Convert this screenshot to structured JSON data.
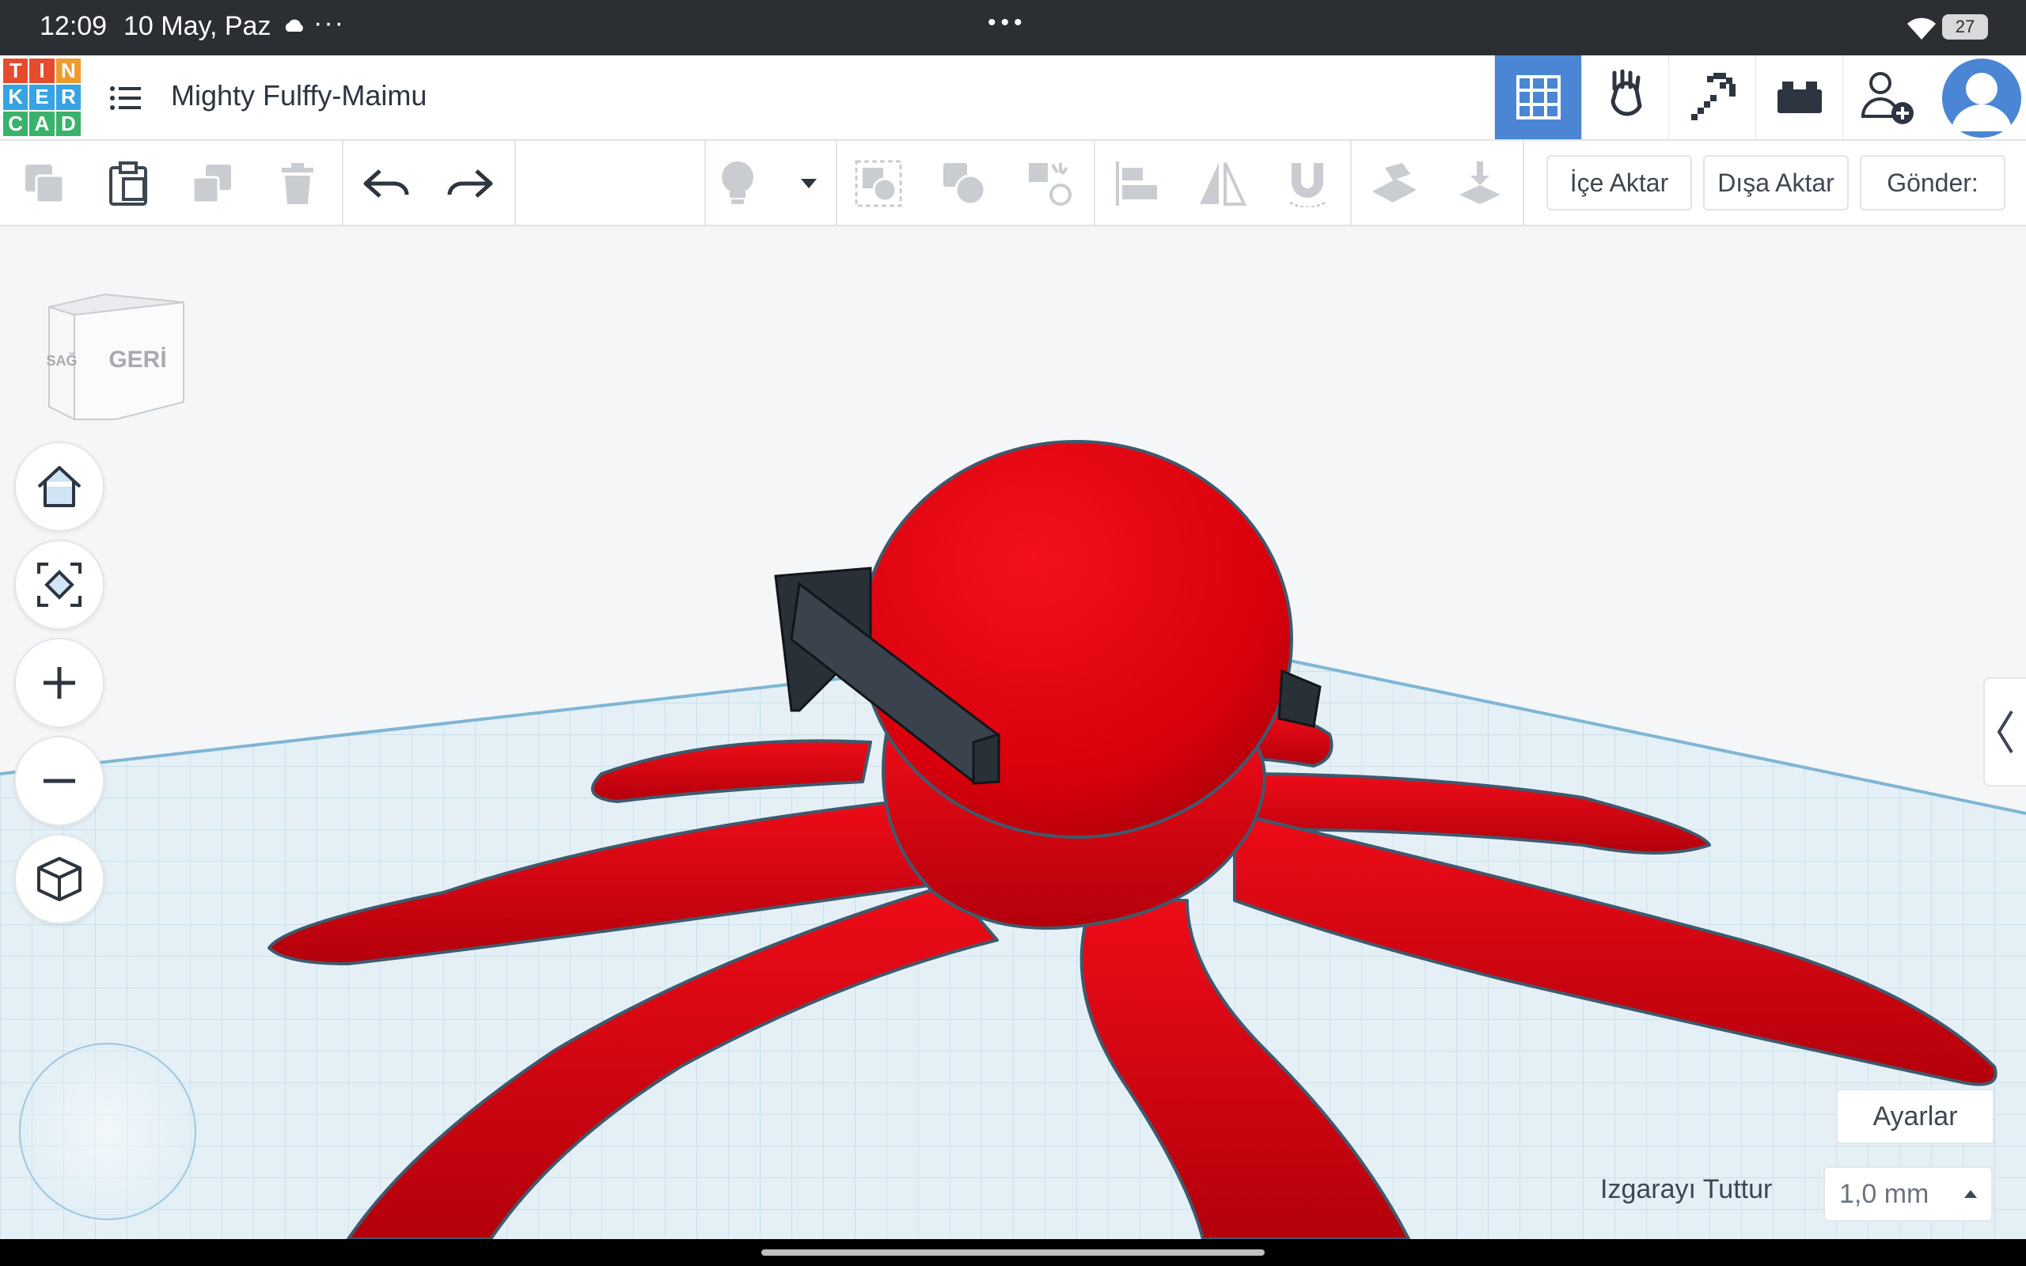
{
  "status_bar": {
    "time": "12:09",
    "date": "10 May, Paz",
    "more": "···",
    "battery": "27"
  },
  "header": {
    "logo_letters": [
      "T",
      "I",
      "N",
      "K",
      "E",
      "R",
      "C",
      "A",
      "D"
    ],
    "logo_colors": [
      "#e64b2e",
      "#e64b2e",
      "#f19a2c",
      "#37a3e0",
      "#37a3e0",
      "#37a3e0",
      "#3ab26b",
      "#3ab26b",
      "#3ab26b"
    ],
    "title": "Mighty Fulffy-Maimu",
    "accent": "#4a86d3"
  },
  "toolbar": {
    "import_label": "İçe Aktar",
    "export_label": "Dışa Aktar",
    "send_label": "Gönder:"
  },
  "viewcube": {
    "front_label": "GERİ",
    "side_label": "SAĞ"
  },
  "workplane": {
    "settings_label": "Ayarlar",
    "snap_label": "Izgarayı Tuttur",
    "snap_value": "1,0 mm"
  },
  "colors": {
    "model_red": "#e3000f",
    "glasses": "#2a3038",
    "grid_line": "#b9d6e6",
    "grid_bg": "#e7f1f7"
  }
}
